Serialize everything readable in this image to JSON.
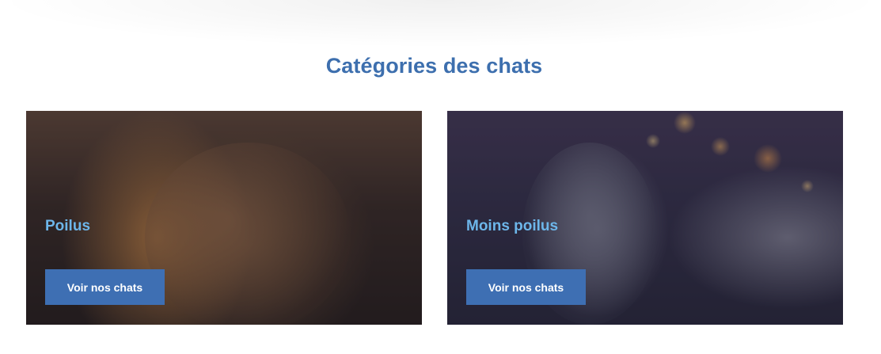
{
  "section": {
    "title": "Catégories des chats"
  },
  "cards": [
    {
      "title": "Poilus",
      "button_label": "Voir nos chats",
      "image": "long-haired-cat-photo"
    },
    {
      "title": "Moins poilus",
      "button_label": "Voir nos chats",
      "image": "short-haired-grey-cat-photo"
    }
  ],
  "colors": {
    "title": "#3d6fae",
    "card_title": "#6db6ea",
    "button": "#3e6fb3"
  }
}
